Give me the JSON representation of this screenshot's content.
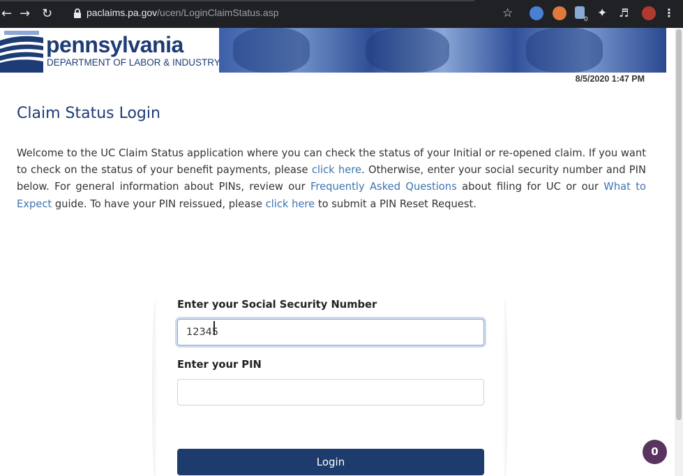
{
  "browser": {
    "url_domain": "paclaims.pa.gov",
    "url_path": "/ucen/LoginClaimStatus.asp",
    "extension_badge": "0"
  },
  "header": {
    "brand": "pennsylvania",
    "department": "DEPARTMENT OF LABOR & INDUSTRY",
    "timestamp": "8/5/2020 1:47 PM"
  },
  "main": {
    "title": "Claim Status Login",
    "intro": {
      "t1": "Welcome to the UC Claim Status application where you can check the status of your Initial or re-opened claim. If you want to check on the status of your benefit payments, please ",
      "link1": "click here",
      "t2": ". Otherwise, enter your social security number and PIN below. For general information about PINs, review our ",
      "link2": "Frequently Asked Questions",
      "t3": " about filing for UC or our ",
      "link3": "What to Expect",
      "t4": " guide. To have your PIN reissued, please ",
      "link4": "click here",
      "t5": " to submit a PIN Reset Request."
    }
  },
  "form": {
    "ssn_label": "Enter your Social Security Number",
    "ssn_value": "12345",
    "pin_label": "Enter your PIN",
    "pin_value": "",
    "login_label": "Login"
  },
  "chat": {
    "count": "0"
  },
  "colors": {
    "accent": "#1d3b75",
    "link": "#3d73b0",
    "button": "#1d3b6c",
    "chat_badge": "#59345f"
  }
}
